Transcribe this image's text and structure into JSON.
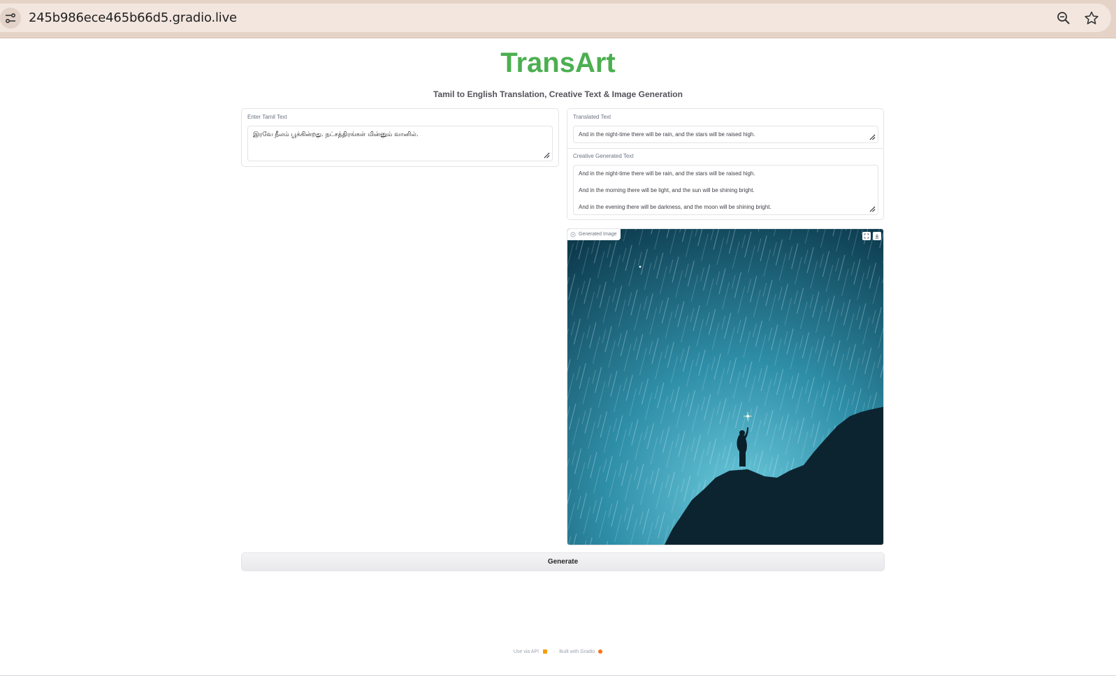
{
  "browser": {
    "url": "245b986ece465b66d5.gradio.live",
    "site_info_icon": "tune-icon",
    "zoom_icon": "zoom-out-icon",
    "bookmark_icon": "star-icon"
  },
  "app": {
    "title": "TransArt",
    "subtitle": "Tamil to English Translation, Creative Text & Image Generation",
    "accent_color": "#4caf50"
  },
  "input": {
    "label": "Enter Tamil Text",
    "value": "இரவே நீலம் பூக்கின்றது. நட்சத்திரங்கள் மின்னும் வானில்."
  },
  "translated": {
    "label": "Translated Text",
    "value": "And in the night-time there will be rain, and the stars will be raised high."
  },
  "creative": {
    "label": "Creative Generated Text",
    "lines": [
      "And in the night-time there will be rain, and the stars will be raised high.",
      "And in the morning there will be light, and the sun will be shining bright.",
      "And in the evening there will be darkness, and the moon will be shining bright."
    ]
  },
  "image": {
    "label": "Generated Image",
    "label_icon": "image-icon",
    "fullscreen_icon": "fullscreen-icon",
    "download_icon": "download-icon"
  },
  "actions": {
    "generate_label": "Generate"
  },
  "footer": {
    "api_link": "Use via API",
    "separator": "·",
    "built_with": "Built with Gradio"
  }
}
